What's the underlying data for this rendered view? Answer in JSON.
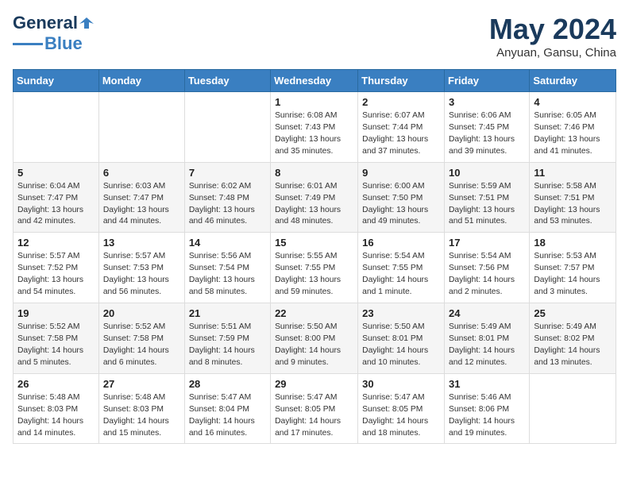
{
  "logo": {
    "line1": "General",
    "line2": "Blue"
  },
  "title": "May 2024",
  "subtitle": "Anyuan, Gansu, China",
  "days_of_week": [
    "Sunday",
    "Monday",
    "Tuesday",
    "Wednesday",
    "Thursday",
    "Friday",
    "Saturday"
  ],
  "weeks": [
    [
      {
        "day": "",
        "text": ""
      },
      {
        "day": "",
        "text": ""
      },
      {
        "day": "",
        "text": ""
      },
      {
        "day": "1",
        "text": "Sunrise: 6:08 AM\nSunset: 7:43 PM\nDaylight: 13 hours\nand 35 minutes."
      },
      {
        "day": "2",
        "text": "Sunrise: 6:07 AM\nSunset: 7:44 PM\nDaylight: 13 hours\nand 37 minutes."
      },
      {
        "day": "3",
        "text": "Sunrise: 6:06 AM\nSunset: 7:45 PM\nDaylight: 13 hours\nand 39 minutes."
      },
      {
        "day": "4",
        "text": "Sunrise: 6:05 AM\nSunset: 7:46 PM\nDaylight: 13 hours\nand 41 minutes."
      }
    ],
    [
      {
        "day": "5",
        "text": "Sunrise: 6:04 AM\nSunset: 7:47 PM\nDaylight: 13 hours\nand 42 minutes."
      },
      {
        "day": "6",
        "text": "Sunrise: 6:03 AM\nSunset: 7:47 PM\nDaylight: 13 hours\nand 44 minutes."
      },
      {
        "day": "7",
        "text": "Sunrise: 6:02 AM\nSunset: 7:48 PM\nDaylight: 13 hours\nand 46 minutes."
      },
      {
        "day": "8",
        "text": "Sunrise: 6:01 AM\nSunset: 7:49 PM\nDaylight: 13 hours\nand 48 minutes."
      },
      {
        "day": "9",
        "text": "Sunrise: 6:00 AM\nSunset: 7:50 PM\nDaylight: 13 hours\nand 49 minutes."
      },
      {
        "day": "10",
        "text": "Sunrise: 5:59 AM\nSunset: 7:51 PM\nDaylight: 13 hours\nand 51 minutes."
      },
      {
        "day": "11",
        "text": "Sunrise: 5:58 AM\nSunset: 7:51 PM\nDaylight: 13 hours\nand 53 minutes."
      }
    ],
    [
      {
        "day": "12",
        "text": "Sunrise: 5:57 AM\nSunset: 7:52 PM\nDaylight: 13 hours\nand 54 minutes."
      },
      {
        "day": "13",
        "text": "Sunrise: 5:57 AM\nSunset: 7:53 PM\nDaylight: 13 hours\nand 56 minutes."
      },
      {
        "day": "14",
        "text": "Sunrise: 5:56 AM\nSunset: 7:54 PM\nDaylight: 13 hours\nand 58 minutes."
      },
      {
        "day": "15",
        "text": "Sunrise: 5:55 AM\nSunset: 7:55 PM\nDaylight: 13 hours\nand 59 minutes."
      },
      {
        "day": "16",
        "text": "Sunrise: 5:54 AM\nSunset: 7:55 PM\nDaylight: 14 hours\nand 1 minute."
      },
      {
        "day": "17",
        "text": "Sunrise: 5:54 AM\nSunset: 7:56 PM\nDaylight: 14 hours\nand 2 minutes."
      },
      {
        "day": "18",
        "text": "Sunrise: 5:53 AM\nSunset: 7:57 PM\nDaylight: 14 hours\nand 3 minutes."
      }
    ],
    [
      {
        "day": "19",
        "text": "Sunrise: 5:52 AM\nSunset: 7:58 PM\nDaylight: 14 hours\nand 5 minutes."
      },
      {
        "day": "20",
        "text": "Sunrise: 5:52 AM\nSunset: 7:58 PM\nDaylight: 14 hours\nand 6 minutes."
      },
      {
        "day": "21",
        "text": "Sunrise: 5:51 AM\nSunset: 7:59 PM\nDaylight: 14 hours\nand 8 minutes."
      },
      {
        "day": "22",
        "text": "Sunrise: 5:50 AM\nSunset: 8:00 PM\nDaylight: 14 hours\nand 9 minutes."
      },
      {
        "day": "23",
        "text": "Sunrise: 5:50 AM\nSunset: 8:01 PM\nDaylight: 14 hours\nand 10 minutes."
      },
      {
        "day": "24",
        "text": "Sunrise: 5:49 AM\nSunset: 8:01 PM\nDaylight: 14 hours\nand 12 minutes."
      },
      {
        "day": "25",
        "text": "Sunrise: 5:49 AM\nSunset: 8:02 PM\nDaylight: 14 hours\nand 13 minutes."
      }
    ],
    [
      {
        "day": "26",
        "text": "Sunrise: 5:48 AM\nSunset: 8:03 PM\nDaylight: 14 hours\nand 14 minutes."
      },
      {
        "day": "27",
        "text": "Sunrise: 5:48 AM\nSunset: 8:03 PM\nDaylight: 14 hours\nand 15 minutes."
      },
      {
        "day": "28",
        "text": "Sunrise: 5:47 AM\nSunset: 8:04 PM\nDaylight: 14 hours\nand 16 minutes."
      },
      {
        "day": "29",
        "text": "Sunrise: 5:47 AM\nSunset: 8:05 PM\nDaylight: 14 hours\nand 17 minutes."
      },
      {
        "day": "30",
        "text": "Sunrise: 5:47 AM\nSunset: 8:05 PM\nDaylight: 14 hours\nand 18 minutes."
      },
      {
        "day": "31",
        "text": "Sunrise: 5:46 AM\nSunset: 8:06 PM\nDaylight: 14 hours\nand 19 minutes."
      },
      {
        "day": "",
        "text": ""
      }
    ]
  ]
}
